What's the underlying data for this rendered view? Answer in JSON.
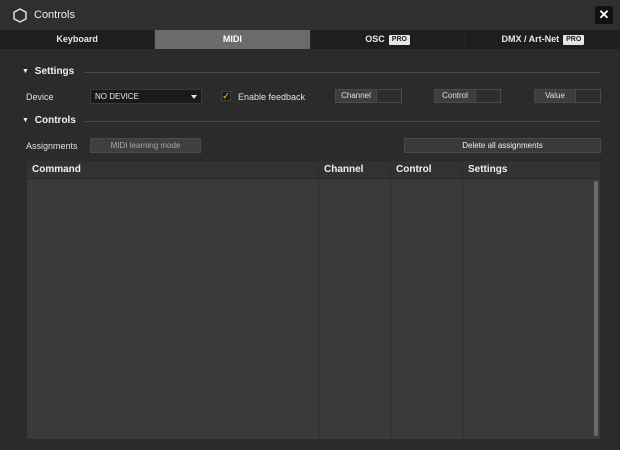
{
  "window": {
    "title": "Controls",
    "close_label": "✕"
  },
  "tabs": [
    {
      "label": "Keyboard",
      "pro": ""
    },
    {
      "label": "MIDI",
      "pro": ""
    },
    {
      "label": "OSC",
      "pro": "PRO"
    },
    {
      "label": "DMX / Art-Net",
      "pro": "PRO"
    }
  ],
  "active_tab": "MIDI",
  "settings": {
    "header": "Settings",
    "device_label": "Device",
    "device_value": "NO DEVICE",
    "enable_feedback_label": "Enable feedback",
    "enable_feedback_checked": true,
    "channel_label": "Channel",
    "control_label": "Control",
    "value_label": "Value"
  },
  "controls": {
    "header": "Controls",
    "assignments_label": "Assignments",
    "learning_button": "MIDI learning mode",
    "delete_button": "Delete all assignments",
    "columns": [
      "Command",
      "Channel",
      "Control",
      "Settings"
    ]
  },
  "colors": {
    "accent_check": "#e09a2a",
    "active_tab": "#6b6b6b"
  }
}
